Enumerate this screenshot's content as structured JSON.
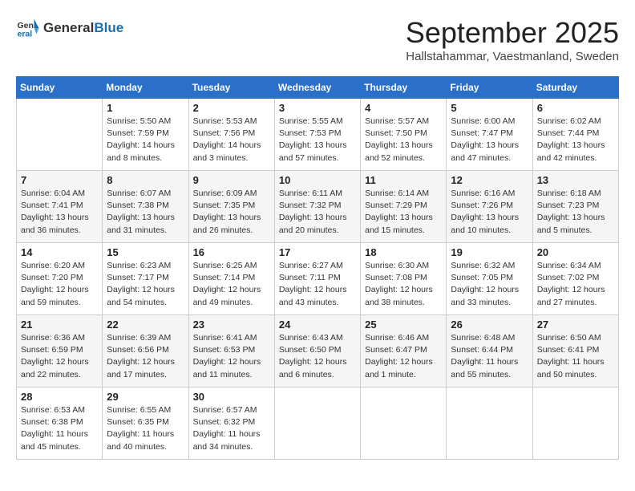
{
  "logo": {
    "text_general": "General",
    "text_blue": "Blue",
    "icon_label": "general-blue-logo"
  },
  "title": "September 2025",
  "subtitle": "Hallstahammar, Vaestmanland, Sweden",
  "weekdays": [
    "Sunday",
    "Monday",
    "Tuesday",
    "Wednesday",
    "Thursday",
    "Friday",
    "Saturday"
  ],
  "weeks": [
    [
      {
        "day": "",
        "info": ""
      },
      {
        "day": "1",
        "info": "Sunrise: 5:50 AM\nSunset: 7:59 PM\nDaylight: 14 hours\nand 8 minutes."
      },
      {
        "day": "2",
        "info": "Sunrise: 5:53 AM\nSunset: 7:56 PM\nDaylight: 14 hours\nand 3 minutes."
      },
      {
        "day": "3",
        "info": "Sunrise: 5:55 AM\nSunset: 7:53 PM\nDaylight: 13 hours\nand 57 minutes."
      },
      {
        "day": "4",
        "info": "Sunrise: 5:57 AM\nSunset: 7:50 PM\nDaylight: 13 hours\nand 52 minutes."
      },
      {
        "day": "5",
        "info": "Sunrise: 6:00 AM\nSunset: 7:47 PM\nDaylight: 13 hours\nand 47 minutes."
      },
      {
        "day": "6",
        "info": "Sunrise: 6:02 AM\nSunset: 7:44 PM\nDaylight: 13 hours\nand 42 minutes."
      }
    ],
    [
      {
        "day": "7",
        "info": "Sunrise: 6:04 AM\nSunset: 7:41 PM\nDaylight: 13 hours\nand 36 minutes."
      },
      {
        "day": "8",
        "info": "Sunrise: 6:07 AM\nSunset: 7:38 PM\nDaylight: 13 hours\nand 31 minutes."
      },
      {
        "day": "9",
        "info": "Sunrise: 6:09 AM\nSunset: 7:35 PM\nDaylight: 13 hours\nand 26 minutes."
      },
      {
        "day": "10",
        "info": "Sunrise: 6:11 AM\nSunset: 7:32 PM\nDaylight: 13 hours\nand 20 minutes."
      },
      {
        "day": "11",
        "info": "Sunrise: 6:14 AM\nSunset: 7:29 PM\nDaylight: 13 hours\nand 15 minutes."
      },
      {
        "day": "12",
        "info": "Sunrise: 6:16 AM\nSunset: 7:26 PM\nDaylight: 13 hours\nand 10 minutes."
      },
      {
        "day": "13",
        "info": "Sunrise: 6:18 AM\nSunset: 7:23 PM\nDaylight: 13 hours\nand 5 minutes."
      }
    ],
    [
      {
        "day": "14",
        "info": "Sunrise: 6:20 AM\nSunset: 7:20 PM\nDaylight: 12 hours\nand 59 minutes."
      },
      {
        "day": "15",
        "info": "Sunrise: 6:23 AM\nSunset: 7:17 PM\nDaylight: 12 hours\nand 54 minutes."
      },
      {
        "day": "16",
        "info": "Sunrise: 6:25 AM\nSunset: 7:14 PM\nDaylight: 12 hours\nand 49 minutes."
      },
      {
        "day": "17",
        "info": "Sunrise: 6:27 AM\nSunset: 7:11 PM\nDaylight: 12 hours\nand 43 minutes."
      },
      {
        "day": "18",
        "info": "Sunrise: 6:30 AM\nSunset: 7:08 PM\nDaylight: 12 hours\nand 38 minutes."
      },
      {
        "day": "19",
        "info": "Sunrise: 6:32 AM\nSunset: 7:05 PM\nDaylight: 12 hours\nand 33 minutes."
      },
      {
        "day": "20",
        "info": "Sunrise: 6:34 AM\nSunset: 7:02 PM\nDaylight: 12 hours\nand 27 minutes."
      }
    ],
    [
      {
        "day": "21",
        "info": "Sunrise: 6:36 AM\nSunset: 6:59 PM\nDaylight: 12 hours\nand 22 minutes."
      },
      {
        "day": "22",
        "info": "Sunrise: 6:39 AM\nSunset: 6:56 PM\nDaylight: 12 hours\nand 17 minutes."
      },
      {
        "day": "23",
        "info": "Sunrise: 6:41 AM\nSunset: 6:53 PM\nDaylight: 12 hours\nand 11 minutes."
      },
      {
        "day": "24",
        "info": "Sunrise: 6:43 AM\nSunset: 6:50 PM\nDaylight: 12 hours\nand 6 minutes."
      },
      {
        "day": "25",
        "info": "Sunrise: 6:46 AM\nSunset: 6:47 PM\nDaylight: 12 hours\nand 1 minute."
      },
      {
        "day": "26",
        "info": "Sunrise: 6:48 AM\nSunset: 6:44 PM\nDaylight: 11 hours\nand 55 minutes."
      },
      {
        "day": "27",
        "info": "Sunrise: 6:50 AM\nSunset: 6:41 PM\nDaylight: 11 hours\nand 50 minutes."
      }
    ],
    [
      {
        "day": "28",
        "info": "Sunrise: 6:53 AM\nSunset: 6:38 PM\nDaylight: 11 hours\nand 45 minutes."
      },
      {
        "day": "29",
        "info": "Sunrise: 6:55 AM\nSunset: 6:35 PM\nDaylight: 11 hours\nand 40 minutes."
      },
      {
        "day": "30",
        "info": "Sunrise: 6:57 AM\nSunset: 6:32 PM\nDaylight: 11 hours\nand 34 minutes."
      },
      {
        "day": "",
        "info": ""
      },
      {
        "day": "",
        "info": ""
      },
      {
        "day": "",
        "info": ""
      },
      {
        "day": "",
        "info": ""
      }
    ]
  ]
}
